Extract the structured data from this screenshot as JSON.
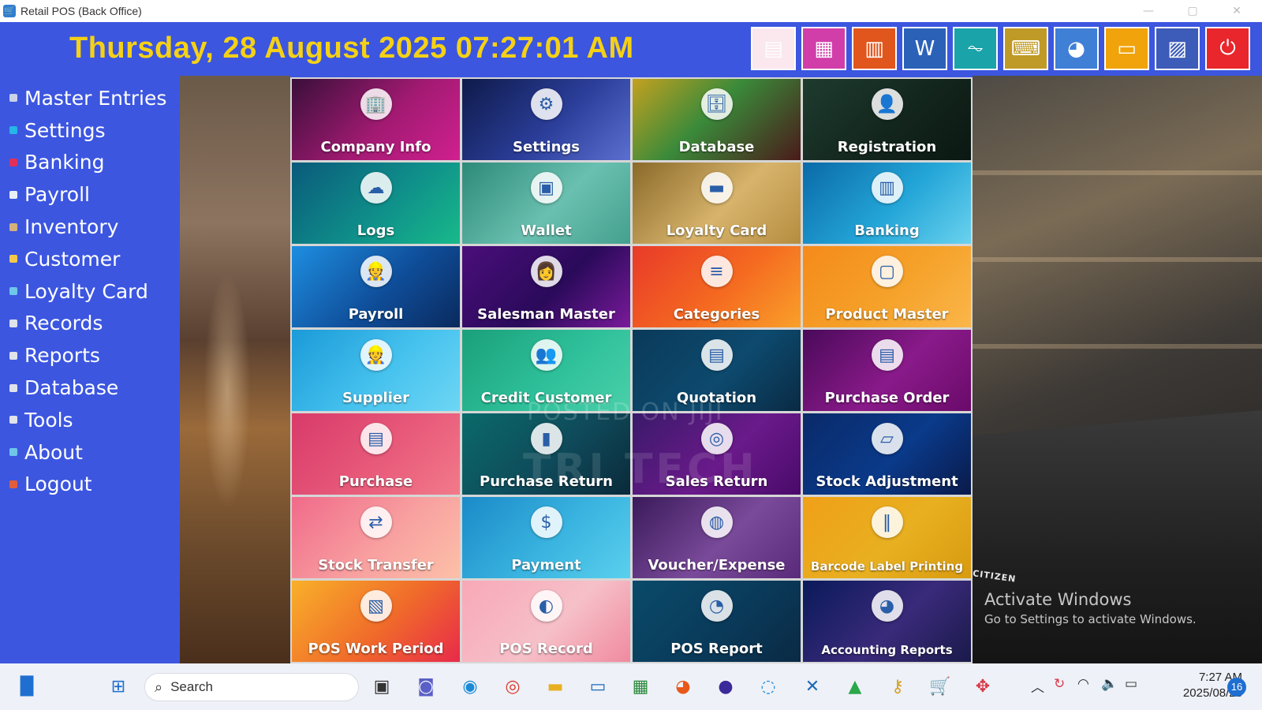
{
  "window": {
    "title": "Retail POS (Back Office)"
  },
  "header": {
    "datetime": "Thursday, 28 August 2025 07:27:01 AM"
  },
  "toolbar": [
    {
      "name": "notepad",
      "icon": "notepad-icon",
      "glyph": "▤",
      "color": "#fbe7ee"
    },
    {
      "name": "calculator",
      "icon": "calculator-icon",
      "glyph": "▦",
      "color": "#d13ea9"
    },
    {
      "name": "notes",
      "icon": "notes-icon",
      "glyph": "▥",
      "color": "#e0561d"
    },
    {
      "name": "word",
      "icon": "word-icon",
      "glyph": "W",
      "color": "#2b62b8"
    },
    {
      "name": "monitor",
      "icon": "activity-monitor-icon",
      "glyph": "⏦",
      "color": "#1aa3a8"
    },
    {
      "name": "keyboard",
      "icon": "keyboard-icon",
      "glyph": "⌨",
      "color": "#c09a26"
    },
    {
      "name": "paint",
      "icon": "paint-icon",
      "glyph": "◕",
      "color": "#3f7fd6"
    },
    {
      "name": "presentation",
      "icon": "presentation-icon",
      "glyph": "▭",
      "color": "#f0a30a"
    },
    {
      "name": "report-viewer",
      "icon": "report-chart-icon",
      "glyph": "▨",
      "color": "#3d5bb8"
    },
    {
      "name": "power",
      "icon": "power-icon",
      "glyph": "⏻",
      "color": "#e8262b"
    }
  ],
  "sidebar": {
    "items": [
      {
        "label": "Master Entries",
        "dot": "#c9d2e8"
      },
      {
        "label": "Settings",
        "dot": "#27b4e6"
      },
      {
        "label": "Banking",
        "dot": "#e0305a"
      },
      {
        "label": "Payroll",
        "dot": "#e8eef8"
      },
      {
        "label": "Inventory",
        "dot": "#d4b07a"
      },
      {
        "label": "Customer",
        "dot": "#f2c94c"
      },
      {
        "label": "Loyalty Card",
        "dot": "#6ec6e8"
      },
      {
        "label": "Records",
        "dot": "#dfe3ea"
      },
      {
        "label": "Reports",
        "dot": "#dfe3ea"
      },
      {
        "label": "Database",
        "dot": "#dfe3ea"
      },
      {
        "label": "Tools",
        "dot": "#dfe3ea"
      },
      {
        "label": "About",
        "dot": "#6ec6e8"
      },
      {
        "label": "Logout",
        "dot": "#e35d3a"
      }
    ]
  },
  "tiles": [
    {
      "label": "Company Info",
      "icon": "company-icon",
      "glyph": "🏢",
      "bg": "linear-gradient(135deg,#3a0f3a,#a21a72 55%,#d0208f)"
    },
    {
      "label": "Settings",
      "icon": "settings-icon",
      "glyph": "⚙",
      "bg": "linear-gradient(135deg,#0e1a4a,#2b3e9a 55%,#5b6fd0)"
    },
    {
      "label": "Database",
      "icon": "database-icon",
      "glyph": "🗄",
      "bg": "linear-gradient(135deg,#c3a120,#3a8a3a 45%,#4a1a1a)"
    },
    {
      "label": "Registration",
      "icon": "registration-icon",
      "glyph": "👤",
      "bg": "linear-gradient(135deg,#1e3b2e,#12241c 60%,#0b1712)"
    },
    {
      "label": "Logs",
      "icon": "logs-icon",
      "glyph": "☁",
      "bg": "linear-gradient(135deg,#0a5a7a,#0f8f8a 55%,#18b98a)"
    },
    {
      "label": "Wallet",
      "icon": "wallet-icon",
      "glyph": "▣",
      "bg": "linear-gradient(135deg,#2d8a78,#6ac0b0 55%,#45a08e)"
    },
    {
      "label": "Loyalty Card",
      "icon": "loyalty-card-icon",
      "glyph": "▬",
      "bg": "linear-gradient(135deg,#8a6a2a,#d7b36b 55%,#b58d40)"
    },
    {
      "label": "Banking",
      "icon": "banking-icon",
      "glyph": "▥",
      "bg": "linear-gradient(135deg,#0a6aa8,#24a6d8 55%,#6ad2ee)"
    },
    {
      "label": "Payroll",
      "icon": "payroll-icon",
      "glyph": "👷",
      "bg": "linear-gradient(135deg,#1e8ee0,#0f4e9a 55%,#0a2a5e)"
    },
    {
      "label": "Salesman Master",
      "icon": "salesman-icon",
      "glyph": "👩",
      "bg": "linear-gradient(135deg,#4a0e7a,#2a0a5a 55%,#7a1a9a)"
    },
    {
      "label": "Categories",
      "icon": "categories-icon",
      "glyph": "≡",
      "bg": "linear-gradient(135deg,#e83a2a,#f56a20 55%,#f9a02a)"
    },
    {
      "label": "Product Master",
      "icon": "product-icon",
      "glyph": "▢",
      "bg": "linear-gradient(135deg,#f58a1a,#f5a22a 55%,#fbb64a)"
    },
    {
      "label": "Supplier",
      "icon": "supplier-icon",
      "glyph": "👷",
      "bg": "linear-gradient(135deg,#1a9ad8,#46c2ee 55%,#6ed6f4)"
    },
    {
      "label": "Credit Customer",
      "icon": "credit-customer-icon",
      "glyph": "👥",
      "bg": "linear-gradient(135deg,#1aa07a,#2ec09a 55%,#4ad0aa)"
    },
    {
      "label": "Quotation",
      "icon": "quotation-icon",
      "glyph": "▤",
      "bg": "linear-gradient(135deg,#0a3a5a,#0d4a6e 55%,#0a2a44)"
    },
    {
      "label": "Purchase Order",
      "icon": "purchase-order-icon",
      "glyph": "▤",
      "bg": "linear-gradient(135deg,#4a0a5a,#8a1a8a 55%,#6a0a6a)"
    },
    {
      "label": "Purchase",
      "icon": "purchase-icon",
      "glyph": "▤",
      "bg": "linear-gradient(135deg,#d83a6a,#e85a7a 55%,#f27a8a)"
    },
    {
      "label": "Purchase Return",
      "icon": "purchase-return-icon",
      "glyph": "▮",
      "bg": "linear-gradient(135deg,#0a6a6a,#0f4a5a 55%,#0a2a3a)"
    },
    {
      "label": "Sales Return",
      "icon": "sales-return-icon",
      "glyph": "◎",
      "bg": "linear-gradient(135deg,#3a1a6a,#6a1a8a 55%,#4a0a6a)"
    },
    {
      "label": "Stock Adjustment",
      "icon": "stock-adjustment-icon",
      "glyph": "▱",
      "bg": "linear-gradient(135deg,#0a2a6a,#0a3a8a 55%,#0a1a4a)"
    },
    {
      "label": "Stock Transfer",
      "icon": "stock-transfer-icon",
      "glyph": "⇄",
      "bg": "linear-gradient(135deg,#f06a8a,#f8a0a0 55%,#fcc0a8)"
    },
    {
      "label": "Payment",
      "icon": "payment-icon",
      "glyph": "$",
      "bg": "linear-gradient(135deg,#1a8ac8,#3ab4e0 55%,#5ad0ee)"
    },
    {
      "label": "Voucher/Expense",
      "icon": "voucher-icon",
      "glyph": "◍",
      "bg": "linear-gradient(135deg,#3a1a5a,#7a4a9a 55%,#5a2a7a)"
    },
    {
      "label": "Barcode Label Printing",
      "icon": "barcode-icon",
      "glyph": "‖",
      "bg": "linear-gradient(135deg,#f0a018,#e8b020 55%,#d89a10)",
      "small": true
    },
    {
      "label": "POS Work Period",
      "icon": "pos-work-period-icon",
      "glyph": "▧",
      "bg": "linear-gradient(135deg,#f8b02a,#f06a2a 55%,#e82a4a)"
    },
    {
      "label": "POS Record",
      "icon": "pos-record-icon",
      "glyph": "◐",
      "bg": "linear-gradient(135deg,#f8a8b8,#f6c0c8 55%,#f08aa0)"
    },
    {
      "label": "POS Report",
      "icon": "pos-report-icon",
      "glyph": "◔",
      "bg": "linear-gradient(135deg,#0a4a6a,#0a3a5a 55%,#0a2a44)"
    },
    {
      "label": "Accounting Reports",
      "icon": "accounting-reports-icon",
      "glyph": "◕",
      "bg": "linear-gradient(135deg,#0a1a5a,#3a2a7a 55%,#1a1a4a)",
      "small": true
    }
  ],
  "watermarks": {
    "line1": "POSTED ON JIJI",
    "line2": "TRI TECH"
  },
  "activation": {
    "title": "Activate Windows",
    "subtitle": "Go to Settings to activate Windows."
  },
  "printer_brand": "CITIZEN",
  "taskbar": {
    "search_placeholder": "Search",
    "time": "7:27 AM",
    "date": "2025/08/28",
    "notifications": "16"
  }
}
